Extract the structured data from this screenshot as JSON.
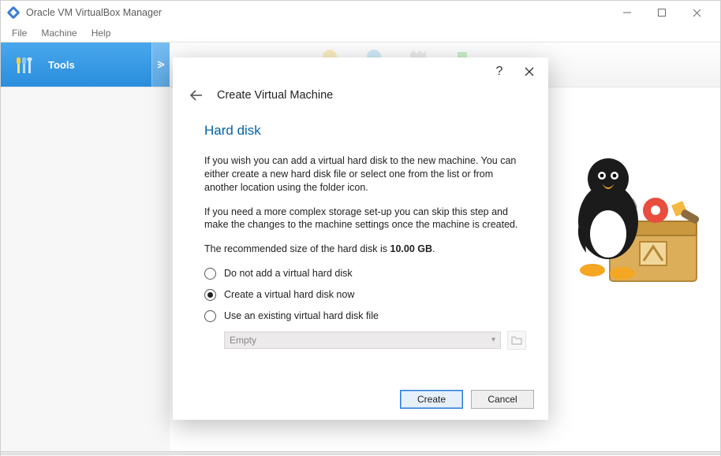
{
  "window": {
    "title": "Oracle VM VirtualBox Manager"
  },
  "menu": {
    "file": "File",
    "machine": "Machine",
    "help": "Help"
  },
  "sidebar": {
    "tools_label": "Tools"
  },
  "dialog": {
    "wizard_title": "Create Virtual Machine",
    "section_title": "Hard disk",
    "para1": "If you wish you can add a virtual hard disk to the new machine. You can either create a new hard disk file or select one from the list or from another location using the folder icon.",
    "para2": "If you need a more complex storage set-up you can skip this step and make the changes to the machine settings once the machine is created.",
    "reco_pre": "The recommended size of the hard disk is ",
    "reco_size": "10.00 GB",
    "reco_post": ".",
    "radio": {
      "none": "Do not add a virtual hard disk",
      "create": "Create a virtual hard disk now",
      "existing": "Use an existing virtual hard disk file"
    },
    "combo_value": "Empty",
    "buttons": {
      "create": "Create",
      "cancel": "Cancel"
    }
  }
}
